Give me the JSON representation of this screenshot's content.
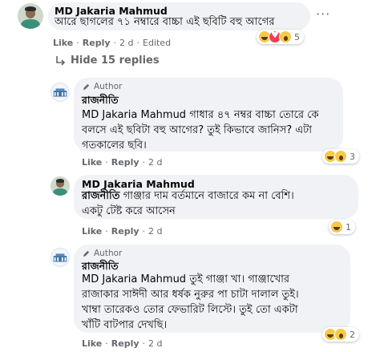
{
  "comment": {
    "author": "MD Jakaria Mahmud",
    "text": "আরে ছাগলের ৭১ নম্বারে বাচ্চা এই ছবিটি বহু আগের",
    "actions": {
      "like": "Like",
      "reply": "Reply",
      "time": "2 d",
      "edited": "Edited"
    },
    "reaction_count": "5"
  },
  "hide_replies": "Hide 15 replies",
  "replies": [
    {
      "author_badge": "Author",
      "page_name": "রাজনীতি",
      "text_line1": "MD Jakaria Mahmud গাধার ৪৭ নম্বর বাচ্চা তোরে কে",
      "text_line2": "বলসে এই ছবিটা বহু আগের? তুই কিভাবে জানিস? এটা",
      "text_line3": "গতকালের ছবি।",
      "actions": {
        "like": "Like",
        "reply": "Reply",
        "time": "2 d"
      },
      "reaction_count": "3"
    },
    {
      "author": "MD Jakaria Mahmud",
      "tag": "রাজনীতি",
      "text_line1": " গাঞ্জার দাম বর্তমানে বাজারে কম না বেশি।",
      "text_line2": "একটু টেষ্ট করে আসেন",
      "actions": {
        "like": "Like",
        "reply": "Reply",
        "time": "2 d"
      },
      "reaction_count": "1"
    },
    {
      "author_badge": "Author",
      "page_name": "রাজনীতি",
      "text_line1": "MD Jakaria Mahmud তুই গাঞ্জা খা। গাঞ্জাখোর",
      "text_line2": "রাজাকার সাঈদী আর ধর্ষক নুরুর পা চাটা দালাল তুই।",
      "text_line3": "খাম্বা তারেকও তোর ফেভারিট লিস্টে। তুই তো একটা",
      "text_line4": "খাঁটি বাটপার দেখছি।",
      "actions": {
        "like": "Like",
        "reply": "Reply",
        "time": "2 d"
      },
      "reaction_count": "2"
    }
  ]
}
